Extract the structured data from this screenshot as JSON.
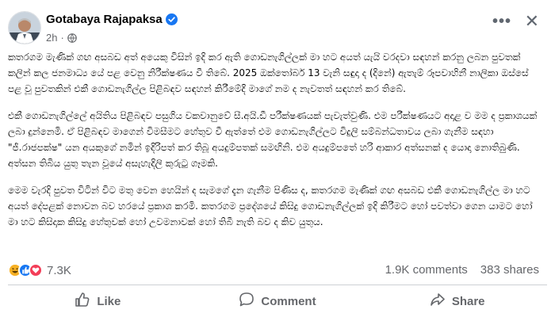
{
  "post": {
    "author": "Gotabaya Rajapaksa",
    "time": "2h",
    "more_icon": "ellipsis-icon",
    "close_icon": "close-icon",
    "paragraphs": [
      "කතරගම මැණික් ගඟ අසබඩ අත් අයෙකු විසින් ඉදි කර ඇති ගොඩනැගිල්ලක් මා හට අයත් යැයි වරදවා සඳහන් කරනු ලබන පුවතක් කලින් කල ජනමාධ්‍ය යේ පළ වෙනු නිරීක්ෂණය වී තිබේ. 2025 ඔක්තෝබර් 13 වැනි සඳුදා ද (දිනේ) ඇතැම් රූපවාහිනී නාලිකා ඔස්සේ පළ වූ පුවතකින් එකී ගොඩනැගිල්ල පිළිබඳව සඳහන් කිරීමේදී මාගේ නම ද නැවතත් සඳහන් කර තිබේ.",
      "එකී ගොඩනැගිල්ලේ අයිතිය පිළිබඳව පසුගිය වකවානුවේ සී.අයි.ඩී පරීක්ෂණයක් පැවැත්වුණි. එම පරීක්ෂණයට අදාළ ව මම ද ප්‍රකාශයක් ලබා දුන්නෙමි. ඒ පිළිබඳව මාගෙන් විමසීමට හේතුව වී ඇත්තේ එම ගොඩනැගිල්ලට විදුලි සම්බන්ධතාවය ලබා ගැනීම සඳහා \"ජී.රාජපක්ෂ\" යන අයකුගේ නමින් ඉදිරිපත් කර තිබූ අයදුම්පතක් සමඟිනි. එම අයදුම්පතේ හරි ආකාර අත්සනක් ද යොදා නොතිබුණි. අත්සන තිබිය යුතු තැන වූයේ අසැහැදිලි කුරුටු ගෑමකි.",
      "මෙම වැරදි පුවත විටින් විට මතු වෙන හෙයින් ද සැමගේ දැන ගැනීම පිණිස ද, කතරගම මැණික් ගඟ අසබඩ එකී ගොඩනැගිල්ල මා හට අයත් දේපළක් නොවන බව හරයේ ප්‍රකාශ කරමි. කතරගම ප්‍රදේශයේ කිසිදු ගොඩනැගිල්ලක් ඉදි කිරීමට හෝ පවත්වා ගෙන යාමට හෝ මා හට කිසිදාක කිසිදු හේතුවක් හෝ උවමනාවක් හෝ තිබී නැති බව ද කිව යුතුය."
    ]
  },
  "reactions": {
    "icons": [
      "haha-icon",
      "like-icon",
      "love-icon"
    ],
    "count": "7.3K",
    "comments": "1.9K comments",
    "shares": "383 shares"
  },
  "actions": {
    "like": "Like",
    "comment": "Comment",
    "share": "Share"
  },
  "colors": {
    "facebook_blue": "#1877f2",
    "love_red": "#f33e58",
    "haha_yellow": "#f7b125",
    "secondary_text": "#65676b"
  }
}
